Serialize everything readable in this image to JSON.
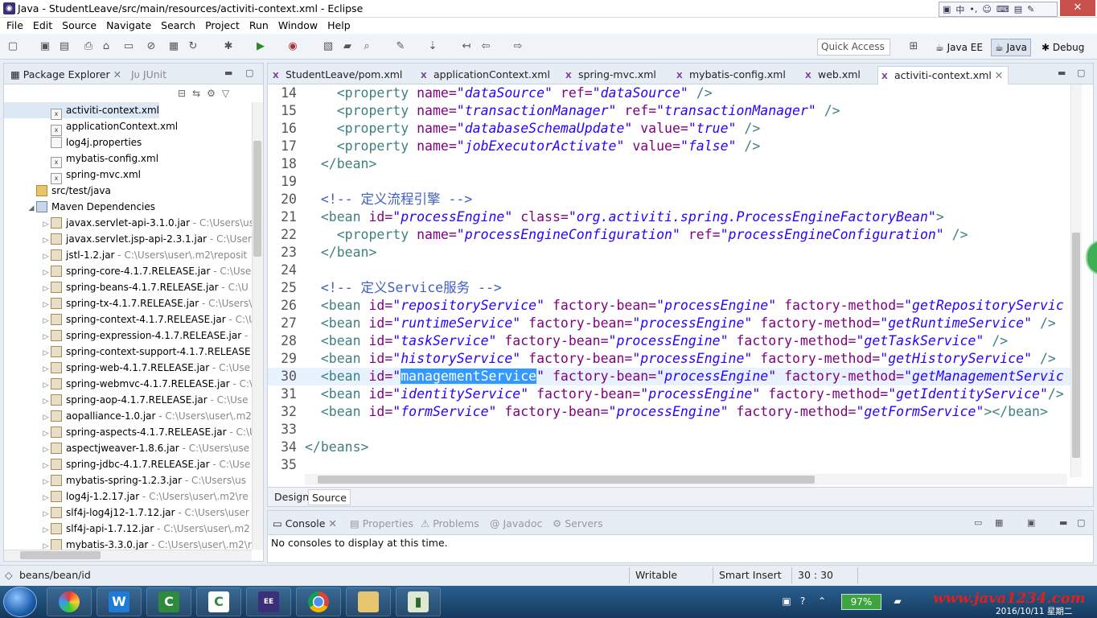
{
  "window": {
    "title": "Java - StudentLeave/src/main/resources/activiti-context.xml - Eclipse"
  },
  "ime_bar": {
    "label": "中"
  },
  "menu": [
    "File",
    "Edit",
    "Source",
    "Navigate",
    "Search",
    "Project",
    "Run",
    "Window",
    "Help"
  ],
  "toolbar": {
    "quick_access_placeholder": "Quick Access"
  },
  "perspectives": [
    "Java EE",
    "Java",
    "Debug"
  ],
  "left_pane": {
    "tabs": [
      "Package Explorer",
      "JUnit"
    ],
    "tree": [
      {
        "label": "activiti-context.xml",
        "dec": "",
        "kind": "xml",
        "indent": 60,
        "sel": true
      },
      {
        "label": "applicationContext.xml",
        "dec": "",
        "kind": "xml",
        "indent": 60
      },
      {
        "label": "log4j.properties",
        "dec": "",
        "kind": "file",
        "indent": 60
      },
      {
        "label": "mybatis-config.xml",
        "dec": "",
        "kind": "xml",
        "indent": 60
      },
      {
        "label": "spring-mvc.xml",
        "dec": "",
        "kind": "xml",
        "indent": 60
      },
      {
        "label": "src/test/java",
        "dec": "",
        "kind": "fold",
        "indent": 42
      },
      {
        "label": "Maven Dependencies",
        "dec": "",
        "kind": "lib",
        "indent": 42,
        "twisty": "◢"
      },
      {
        "label": "javax.servlet-api-3.1.0.jar",
        "dec": " - C:\\Users\\us",
        "kind": "jar",
        "indent": 60,
        "twisty": "▷"
      },
      {
        "label": "javax.servlet.jsp-api-2.3.1.jar",
        "dec": " - C:\\Users\\",
        "kind": "jar",
        "indent": 60,
        "twisty": "▷"
      },
      {
        "label": "jstl-1.2.jar",
        "dec": " - C:\\Users\\user\\.m2\\reposit",
        "kind": "jar",
        "indent": 60,
        "twisty": "▷"
      },
      {
        "label": "spring-core-4.1.7.RELEASE.jar",
        "dec": " - C:\\Use",
        "kind": "jar",
        "indent": 60,
        "twisty": "▷"
      },
      {
        "label": "spring-beans-4.1.7.RELEASE.jar",
        "dec": " - C:\\U",
        "kind": "jar",
        "indent": 60,
        "twisty": "▷"
      },
      {
        "label": "spring-tx-4.1.7.RELEASE.jar",
        "dec": " - C:\\Users\\",
        "kind": "jar",
        "indent": 60,
        "twisty": "▷"
      },
      {
        "label": "spring-context-4.1.7.RELEASE.jar",
        "dec": " - C:\\U",
        "kind": "jar",
        "indent": 60,
        "twisty": "▷"
      },
      {
        "label": "spring-expression-4.1.7.RELEASE.jar",
        "dec": " -",
        "kind": "jar",
        "indent": 60,
        "twisty": "▷"
      },
      {
        "label": "spring-context-support-4.1.7.RELEASE",
        "dec": "",
        "kind": "jar",
        "indent": 60,
        "twisty": "▷"
      },
      {
        "label": "spring-web-4.1.7.RELEASE.jar",
        "dec": " - C:\\Use",
        "kind": "jar",
        "indent": 60,
        "twisty": "▷"
      },
      {
        "label": "spring-webmvc-4.1.7.RELEASE.jar",
        "dec": " - C:\\",
        "kind": "jar",
        "indent": 60,
        "twisty": "▷"
      },
      {
        "label": "spring-aop-4.1.7.RELEASE.jar",
        "dec": " - C:\\Use",
        "kind": "jar",
        "indent": 60,
        "twisty": "▷"
      },
      {
        "label": "aopalliance-1.0.jar",
        "dec": " - C:\\Users\\user\\.m2",
        "kind": "jar",
        "indent": 60,
        "twisty": "▷"
      },
      {
        "label": "spring-aspects-4.1.7.RELEASE.jar",
        "dec": " - C:\\U",
        "kind": "jar",
        "indent": 60,
        "twisty": "▷"
      },
      {
        "label": "aspectjweaver-1.8.6.jar",
        "dec": " - C:\\Users\\use",
        "kind": "jar",
        "indent": 60,
        "twisty": "▷"
      },
      {
        "label": "spring-jdbc-4.1.7.RELEASE.jar",
        "dec": " - C:\\Use",
        "kind": "jar",
        "indent": 60,
        "twisty": "▷"
      },
      {
        "label": "mybatis-spring-1.2.3.jar",
        "dec": " - C:\\Users\\us",
        "kind": "jar",
        "indent": 60,
        "twisty": "▷"
      },
      {
        "label": "log4j-1.2.17.jar",
        "dec": " - C:\\Users\\user\\.m2\\re",
        "kind": "jar",
        "indent": 60,
        "twisty": "▷"
      },
      {
        "label": "slf4j-log4j12-1.7.12.jar",
        "dec": " - C:\\Users\\user",
        "kind": "jar",
        "indent": 60,
        "twisty": "▷"
      },
      {
        "label": "slf4j-api-1.7.12.jar",
        "dec": " - C:\\Users\\user\\.m2",
        "kind": "jar",
        "indent": 60,
        "twisty": "▷"
      },
      {
        "label": "mybatis-3.3.0.jar",
        "dec": " - C:\\Users\\user\\.m2\\r",
        "kind": "jar",
        "indent": 60,
        "twisty": "▷"
      }
    ]
  },
  "editor": {
    "tabs": [
      "StudentLeave/pom.xml",
      "applicationContext.xml",
      "spring-mvc.xml",
      "mybatis-config.xml",
      "web.xml",
      "activiti-context.xml"
    ],
    "active_tab": 5,
    "current_line": 30,
    "lines": [
      {
        "n": "14",
        "parts": [
          [
            "p",
            "  "
          ],
          [
            "t",
            "<property "
          ],
          [
            "a",
            "name="
          ],
          [
            "v",
            "\"dataSource\""
          ],
          [
            "a",
            " ref="
          ],
          [
            "v",
            "\"dataSource\""
          ],
          [
            "t",
            " />"
          ]
        ]
      },
      {
        "n": "15",
        "parts": [
          [
            "p",
            "  "
          ],
          [
            "t",
            "<property "
          ],
          [
            "a",
            "name="
          ],
          [
            "v",
            "\"transactionManager\""
          ],
          [
            "a",
            " ref="
          ],
          [
            "v",
            "\"transactionManager\""
          ],
          [
            "t",
            " />"
          ]
        ]
      },
      {
        "n": "16",
        "parts": [
          [
            "p",
            "  "
          ],
          [
            "t",
            "<property "
          ],
          [
            "a",
            "name="
          ],
          [
            "v",
            "\"databaseSchemaUpdate\""
          ],
          [
            "a",
            " value="
          ],
          [
            "v",
            "\"true\""
          ],
          [
            "t",
            " />"
          ]
        ]
      },
      {
        "n": "17",
        "parts": [
          [
            "p",
            "  "
          ],
          [
            "t",
            "<property "
          ],
          [
            "a",
            "name="
          ],
          [
            "v",
            "\"jobExecutorActivate\""
          ],
          [
            "a",
            " value="
          ],
          [
            "v",
            "\"false\""
          ],
          [
            "t",
            " />"
          ]
        ]
      },
      {
        "n": "18",
        "parts": [
          [
            "t",
            "</bean>"
          ]
        ]
      },
      {
        "n": "19",
        "parts": []
      },
      {
        "n": "20",
        "parts": [
          [
            "c",
            "<!-- 定义流程引擎 -->"
          ]
        ]
      },
      {
        "n": "21",
        "parts": [
          [
            "t",
            "<bean "
          ],
          [
            "a",
            "id="
          ],
          [
            "v",
            "\"processEngine\""
          ],
          [
            "a",
            " class="
          ],
          [
            "v",
            "\"org.activiti.spring.ProcessEngineFactoryBean\""
          ],
          [
            "t",
            ">"
          ]
        ]
      },
      {
        "n": "22",
        "parts": [
          [
            "p",
            "  "
          ],
          [
            "t",
            "<property "
          ],
          [
            "a",
            "name="
          ],
          [
            "v",
            "\"processEngineConfiguration\""
          ],
          [
            "a",
            " ref="
          ],
          [
            "v",
            "\"processEngineConfiguration\""
          ],
          [
            "t",
            " />"
          ]
        ]
      },
      {
        "n": "23",
        "parts": [
          [
            "t",
            "</bean>"
          ]
        ]
      },
      {
        "n": "24",
        "parts": []
      },
      {
        "n": "25",
        "parts": [
          [
            "c",
            "<!-- 定义Service服务 -->"
          ]
        ]
      },
      {
        "n": "26",
        "parts": [
          [
            "t",
            "<bean "
          ],
          [
            "a",
            "id="
          ],
          [
            "v",
            "\"repositoryService\""
          ],
          [
            "a",
            " factory-bean="
          ],
          [
            "v",
            "\"processEngine\""
          ],
          [
            "a",
            " factory-method="
          ],
          [
            "v",
            "\"getRepositoryServic"
          ]
        ]
      },
      {
        "n": "27",
        "parts": [
          [
            "t",
            "<bean "
          ],
          [
            "a",
            "id="
          ],
          [
            "v",
            "\"runtimeService\""
          ],
          [
            "a",
            " factory-bean="
          ],
          [
            "v",
            "\"processEngine\""
          ],
          [
            "a",
            " factory-method="
          ],
          [
            "v",
            "\"getRuntimeService\""
          ],
          [
            "t",
            " />"
          ]
        ]
      },
      {
        "n": "28",
        "parts": [
          [
            "t",
            "<bean "
          ],
          [
            "a",
            "id="
          ],
          [
            "v",
            "\"taskService\""
          ],
          [
            "a",
            " factory-bean="
          ],
          [
            "v",
            "\"processEngine\""
          ],
          [
            "a",
            " factory-method="
          ],
          [
            "v",
            "\"getTaskService\""
          ],
          [
            "t",
            " />"
          ]
        ]
      },
      {
        "n": "29",
        "parts": [
          [
            "t",
            "<bean "
          ],
          [
            "a",
            "id="
          ],
          [
            "v",
            "\"historyService\""
          ],
          [
            "a",
            " factory-bean="
          ],
          [
            "v",
            "\"processEngine\""
          ],
          [
            "a",
            " factory-method="
          ],
          [
            "v",
            "\"getHistoryService\""
          ],
          [
            "t",
            " />"
          ]
        ]
      },
      {
        "n": "30",
        "parts": [
          [
            "t",
            "<bean "
          ],
          [
            "a",
            "id="
          ],
          [
            "v",
            "\""
          ],
          [
            "hl",
            "managementService"
          ],
          [
            "v",
            "\""
          ],
          [
            "a",
            " factory-bean="
          ],
          [
            "v",
            "\"processEngine\""
          ],
          [
            "a",
            " factory-method="
          ],
          [
            "v",
            "\"getManagementServic"
          ]
        ]
      },
      {
        "n": "31",
        "parts": [
          [
            "t",
            "<bean "
          ],
          [
            "a",
            "id="
          ],
          [
            "v",
            "\"identityService\""
          ],
          [
            "a",
            " factory-bean="
          ],
          [
            "v",
            "\"processEngine\""
          ],
          [
            "a",
            " factory-method="
          ],
          [
            "v",
            "\"getIdentityService\""
          ],
          [
            "t",
            "/>"
          ]
        ]
      },
      {
        "n": "32",
        "parts": [
          [
            "t",
            "<bean "
          ],
          [
            "a",
            "id="
          ],
          [
            "v",
            "\"formService\""
          ],
          [
            "a",
            " factory-bean="
          ],
          [
            "v",
            "\"processEngine\""
          ],
          [
            "a",
            " factory-method="
          ],
          [
            "v",
            "\"getFormService\""
          ],
          [
            "t",
            "></bean>"
          ]
        ]
      },
      {
        "n": "33",
        "parts": []
      },
      {
        "n": "34",
        "parts": [
          [
            "t",
            "</beans>"
          ]
        ]
      },
      {
        "n": "35",
        "parts": []
      }
    ],
    "bottom_tabs": [
      "Design",
      "Source"
    ]
  },
  "console": {
    "tabs": [
      "Console",
      "Properties",
      "Problems",
      "Javadoc",
      "Servers"
    ],
    "message": "No consoles to display at this time."
  },
  "status": {
    "path": "beans/bean/id",
    "writable": "Writable",
    "insert_mode": "Smart Insert",
    "position": "30 : 30"
  },
  "taskbar": {
    "battery": "97%",
    "watermark": "www.java1234.com",
    "date": "2016/10/11 星期二"
  },
  "colors": {
    "tag": "#3f7f7f",
    "attr": "#7f007f",
    "value": "#2a00ff",
    "comment": "#3f5fbf",
    "selection": "#3399ff"
  }
}
